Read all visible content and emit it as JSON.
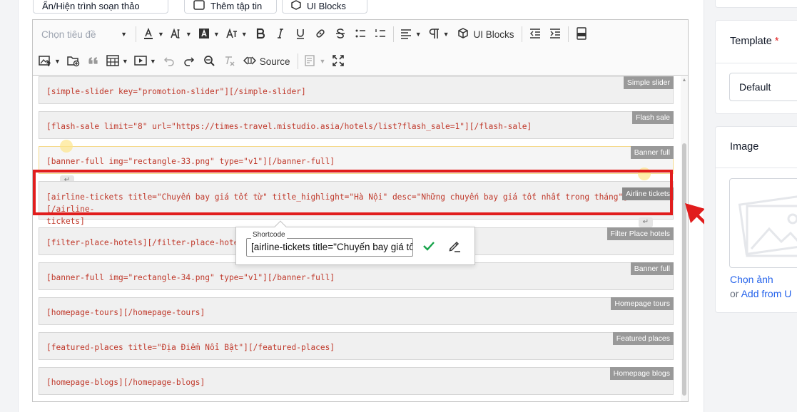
{
  "top_buttons": {
    "toggle_editor": "Ẩn/Hiện trình soạn thảo",
    "add_file": "Thêm tập tin",
    "ui_blocks": "UI Blocks"
  },
  "toolbar": {
    "heading_placeholder": "Chọn tiêu đề",
    "ui_blocks_label": "UI Blocks",
    "source_label": "Source",
    "icons": [
      "font-color-icon",
      "font-size-icon",
      "background-color-icon",
      "font-family-icon",
      "bold-icon",
      "italic-icon",
      "underline-icon",
      "link-icon",
      "strikethrough-icon",
      "bulleted-list-icon",
      "numbered-list-icon",
      "align-icon",
      "paragraph-direction-icon",
      "ui-blocks-icon",
      "outdent-icon",
      "indent-icon",
      "html-embed-icon",
      "insert-image-icon",
      "ckfinder-icon",
      "blockquote-icon",
      "table-icon",
      "media-embed-icon",
      "undo-icon",
      "redo-icon",
      "find-replace-icon",
      "remove-format-icon",
      "source-icon",
      "templates-icon",
      "fullscreen-icon"
    ]
  },
  "blocks": [
    {
      "code": "[simple-slider key=\"promotion-slider\"][/simple-slider]",
      "tag": "Simple slider"
    },
    {
      "code": "[flash-sale limit=\"8\" url=\"https://times-travel.mistudio.asia/hotels/list?flash_sale=1\"][/flash-sale]",
      "tag": "Flash sale"
    },
    {
      "code": "[banner-full img=\"rectangle-33.png\" type=\"v1\"][/banner-full]",
      "tag": "Banner full"
    },
    {
      "code": "[airline-tickets title=\"Chuyến bay giá tốt từ\" title_highlight=\"Hà Nội\" desc=\"Những chuyến bay giá tốt nhất trong tháng\"][/airline-tickets]",
      "code_line1": "[airline-tickets title=\"Chuyến bay giá tốt từ\" title_highlight=\"Hà Nội\" desc=\"Những chuyến bay giá tốt nhất trong tháng\"][/airline-",
      "code_line2": "tickets]",
      "tag": "Airline tickets"
    },
    {
      "code": "[filter-place-hotels][/filter-place-hotels]",
      "code_visible": "[filter-place-hotels][/filter-place-hotel",
      "tag": "Filter Place hotels"
    },
    {
      "code": "[banner-full img=\"rectangle-34.png\" type=\"v1\"][/banner-full]",
      "tag": "Banner full"
    },
    {
      "code": "[homepage-tours][/homepage-tours]",
      "tag": "Homepage tours"
    },
    {
      "code": "[featured-places title=\"Địa Điểm Nổi Bật\"][/featured-places]",
      "tag": "Featured places"
    },
    {
      "code": "[homepage-blogs][/homepage-blogs]",
      "tag": "Homepage blogs"
    }
  ],
  "balloon": {
    "label": "Shortcode",
    "value": "[airline-tickets title=\"Chuyến bay giá tố"
  },
  "sidebar": {
    "template_title": "Template",
    "required_mark": "*",
    "template_value": "Default",
    "image_title": "Image",
    "choose_image": "Chọn ảnh",
    "or_text": "or",
    "add_from_url": "Add from U"
  },
  "colors": {
    "highlight_red": "#e11d1d",
    "shortcode_text": "#c0392b",
    "link_blue": "#2563eb",
    "tag_gray": "#999999"
  }
}
